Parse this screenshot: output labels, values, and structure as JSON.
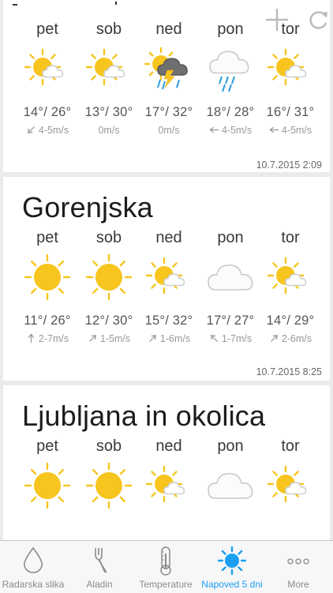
{
  "colors": {
    "accent": "#1a9ff2",
    "sun": "#f7c51e"
  },
  "cards": [
    {
      "title": "",
      "timestamp": "10.7.2015 2:09",
      "days": [
        {
          "name": "pet",
          "icon": "sun-cloud-icon",
          "temp": "14°/ 26°",
          "wind": "4-5m/s",
          "arrow": "arrow-sw-icon"
        },
        {
          "name": "sob",
          "icon": "sun-cloud-icon",
          "temp": "13°/ 30°",
          "wind": "0m/s",
          "arrow": ""
        },
        {
          "name": "ned",
          "icon": "thunderstorm-icon",
          "temp": "17°/ 32°",
          "wind": "0m/s",
          "arrow": ""
        },
        {
          "name": "pon",
          "icon": "rain-icon",
          "temp": "18°/ 28°",
          "wind": "4-5m/s",
          "arrow": "arrow-w-icon"
        },
        {
          "name": "tor",
          "icon": "sun-cloud-icon",
          "temp": "16°/ 31°",
          "wind": "4-5m/s",
          "arrow": "arrow-w-icon"
        }
      ]
    },
    {
      "title": "Gorenjska",
      "timestamp": "10.7.2015 8:25",
      "days": [
        {
          "name": "pet",
          "icon": "sun-icon",
          "temp": "11°/ 26°",
          "wind": "2-7m/s",
          "arrow": "arrow-n-icon"
        },
        {
          "name": "sob",
          "icon": "sun-icon",
          "temp": "12°/ 30°",
          "wind": "1-5m/s",
          "arrow": "arrow-ne-icon"
        },
        {
          "name": "ned",
          "icon": "sun-cloud-icon",
          "temp": "15°/ 32°",
          "wind": "1-6m/s",
          "arrow": "arrow-ne-icon"
        },
        {
          "name": "pon",
          "icon": "cloud-icon",
          "temp": "17°/ 27°",
          "wind": "1-7m/s",
          "arrow": "arrow-nw-icon"
        },
        {
          "name": "tor",
          "icon": "sun-cloud-icon",
          "temp": "14°/ 29°",
          "wind": "2-6m/s",
          "arrow": "arrow-ne-icon"
        }
      ]
    },
    {
      "title": "Ljubljana in okolica",
      "timestamp": "",
      "days": [
        {
          "name": "pet",
          "icon": "sun-icon",
          "temp": "",
          "wind": "",
          "arrow": ""
        },
        {
          "name": "sob",
          "icon": "sun-icon",
          "temp": "",
          "wind": "",
          "arrow": ""
        },
        {
          "name": "ned",
          "icon": "sun-cloud-icon",
          "temp": "",
          "wind": "",
          "arrow": ""
        },
        {
          "name": "pon",
          "icon": "cloud-icon",
          "temp": "",
          "wind": "",
          "arrow": ""
        },
        {
          "name": "tor",
          "icon": "sun-cloud-icon",
          "temp": "",
          "wind": "",
          "arrow": ""
        }
      ]
    }
  ],
  "toolbar": {
    "add_icon": "plus-icon",
    "refresh_icon": "refresh-icon"
  },
  "tabs": [
    {
      "label": "Radarska slika",
      "icon": "drop-icon",
      "active": false
    },
    {
      "label": "Aladin",
      "icon": "fork-icon",
      "active": false
    },
    {
      "label": "Temperature",
      "icon": "thermometer-icon",
      "active": false
    },
    {
      "label": "Napoved 5 dni",
      "icon": "sun-icon",
      "active": true
    },
    {
      "label": "More",
      "icon": "more-icon",
      "active": false
    }
  ]
}
